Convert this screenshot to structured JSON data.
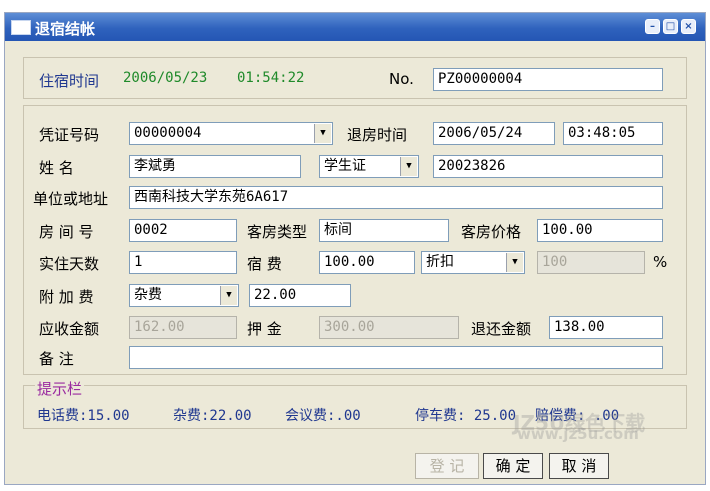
{
  "window": {
    "title": "退宿结帐"
  },
  "stay": {
    "label": "住宿时间",
    "date": "2006/05/23",
    "time": "01:54:22",
    "no_label": "No.",
    "no_value": "PZ00000004"
  },
  "form": {
    "voucher_label": "凭证号码",
    "voucher_value": "00000004",
    "checkout_label": "退房时间",
    "checkout_date": "2006/05/24",
    "checkout_time": "03:48:05",
    "name_label": "姓    名",
    "name_value": "李斌勇",
    "id_type": "学生证",
    "id_number": "20023826",
    "address_label": "单位或地址",
    "address_value": "西南科技大学东苑6A617",
    "room_no_label": "房 间 号",
    "room_no_value": "0002",
    "room_type_label": "客房类型",
    "room_type_value": "标间",
    "room_price_label": "客房价格",
    "room_price_value": "100.00",
    "days_label": "实住天数",
    "days_value": "1",
    "lodging_label": "宿    费",
    "lodging_value": "100.00",
    "discount_label": "折扣",
    "discount_value": "100",
    "percent": "%",
    "extra_label": "附 加 费",
    "extra_type": "杂费",
    "extra_value": "22.00",
    "receivable_label": "应收金额",
    "receivable_value": "162.00",
    "deposit_label": "押    金",
    "deposit_value": "300.00",
    "refund_label": "退还金额",
    "refund_value": "138.00",
    "remark_label": "备    注",
    "remark_value": ""
  },
  "hints": {
    "title": "提示栏",
    "items": [
      "电话费:15.00",
      "杂费:22.00",
      "会议费:.00",
      "停车费: 25.00",
      "赔偿费: .00"
    ]
  },
  "buttons": {
    "register": "登 记",
    "confirm": "确 定",
    "cancel": "取 消"
  },
  "watermark": {
    "brand": "JZ5U绿色下载",
    "url": "www.jz5u.com"
  }
}
